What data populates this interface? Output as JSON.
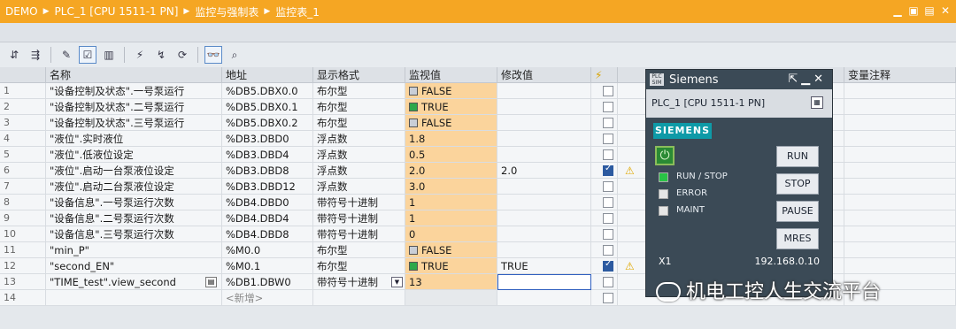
{
  "titlebar": {
    "crumbs": [
      "DEMO",
      "PLC_1 [CPU 1511-1 PN]",
      "监控与强制表",
      "监控表_1"
    ],
    "window_controls": [
      "minimize-icon",
      "restore-icon",
      "menu-icon",
      "close-icon"
    ]
  },
  "toolbar": {
    "icons": [
      "insert-row-icon",
      "add-row-icon",
      "rename-icon",
      "monitor-edit-icon",
      "format-icon",
      "modify-now-icon",
      "modify-trigger-icon",
      "modify-all-icon",
      "monitor-all-icon",
      "monitor-once-icon"
    ]
  },
  "table": {
    "headers": [
      "名称",
      "地址",
      "显示格式",
      "监视值",
      "修改值",
      "",
      "",
      "变量注释"
    ],
    "rows": [
      {
        "num": "1",
        "name": "\"设备控制及状态\".一号泵运行",
        "addr": "%DB5.DBX0.0",
        "fmt": "布尔型",
        "mon": "FALSE",
        "mon_kind": "false",
        "mod": "",
        "chk": false,
        "warn": false
      },
      {
        "num": "2",
        "name": "\"设备控制及状态\".二号泵运行",
        "addr": "%DB5.DBX0.1",
        "fmt": "布尔型",
        "mon": "TRUE",
        "mon_kind": "true",
        "mod": "",
        "chk": false,
        "warn": false
      },
      {
        "num": "3",
        "name": "\"设备控制及状态\".三号泵运行",
        "addr": "%DB5.DBX0.2",
        "fmt": "布尔型",
        "mon": "FALSE",
        "mon_kind": "false",
        "mod": "",
        "chk": false,
        "warn": false
      },
      {
        "num": "4",
        "name": "\"液位\".实时液位",
        "addr": "%DB3.DBD0",
        "fmt": "浮点数",
        "mon": "1.8",
        "mon_kind": "",
        "mod": "",
        "chk": false,
        "warn": false
      },
      {
        "num": "5",
        "name": "\"液位\".低液位设定",
        "addr": "%DB3.DBD4",
        "fmt": "浮点数",
        "mon": "0.5",
        "mon_kind": "",
        "mod": "",
        "chk": false,
        "warn": false
      },
      {
        "num": "6",
        "name": "\"液位\".启动一台泵液位设定",
        "addr": "%DB3.DBD8",
        "fmt": "浮点数",
        "mon": "2.0",
        "mon_kind": "",
        "mod": "2.0",
        "chk": true,
        "warn": true
      },
      {
        "num": "7",
        "name": "\"液位\".启动二台泵液位设定",
        "addr": "%DB3.DBD12",
        "fmt": "浮点数",
        "mon": "3.0",
        "mon_kind": "",
        "mod": "",
        "chk": false,
        "warn": false
      },
      {
        "num": "8",
        "name": "\"设备信息\".一号泵运行次数",
        "addr": "%DB4.DBD0",
        "fmt": "带符号十进制",
        "mon": "1",
        "mon_kind": "",
        "mod": "",
        "chk": false,
        "warn": false
      },
      {
        "num": "9",
        "name": "\"设备信息\".二号泵运行次数",
        "addr": "%DB4.DBD4",
        "fmt": "带符号十进制",
        "mon": "1",
        "mon_kind": "",
        "mod": "",
        "chk": false,
        "warn": false
      },
      {
        "num": "10",
        "name": "\"设备信息\".三号泵运行次数",
        "addr": "%DB4.DBD8",
        "fmt": "带符号十进制",
        "mon": "0",
        "mon_kind": "",
        "mod": "",
        "chk": false,
        "warn": false
      },
      {
        "num": "11",
        "name": "\"min_P\"",
        "addr": "%M0.0",
        "fmt": "布尔型",
        "mon": "FALSE",
        "mon_kind": "false",
        "mod": "",
        "chk": false,
        "warn": false
      },
      {
        "num": "12",
        "name": "\"second_EN\"",
        "addr": "%M0.1",
        "fmt": "布尔型",
        "mon": "TRUE",
        "mon_kind": "true",
        "mod": "TRUE",
        "chk": true,
        "warn": true
      },
      {
        "num": "13",
        "name": "\"TIME_test\".view_second",
        "addr": "%DB1.DBW0",
        "fmt": "带符号十进制",
        "mon": "13",
        "mon_kind": "",
        "mod": "",
        "chk": false,
        "warn": false
      },
      {
        "num": "14",
        "name": "",
        "addr": "<新增>",
        "fmt": "",
        "mon": "",
        "mon_kind": "",
        "mod": "",
        "chk": false,
        "warn": false,
        "blank": true
      }
    ]
  },
  "plcsim": {
    "title": "Siemens",
    "logo": "PLC SIM",
    "device": "PLC_1 [CPU 1511-1 PN]",
    "brand": "SIEMENS",
    "leds": [
      {
        "label": "RUN / STOP",
        "color": "green"
      },
      {
        "label": "ERROR",
        "color": "white"
      },
      {
        "label": "MAINT",
        "color": "white"
      }
    ],
    "buttons": [
      "RUN",
      "STOP",
      "PAUSE",
      "MRES"
    ],
    "port": "X1",
    "ip": "192.168.0.10"
  },
  "watermark": "机电工控人生交流平台"
}
